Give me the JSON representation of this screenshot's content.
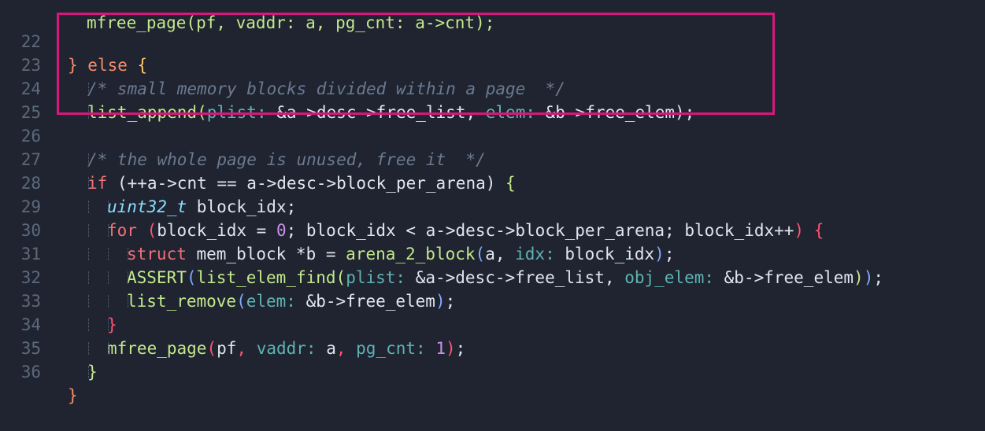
{
  "editor": {
    "top_partial": "mfree_page(pf, vaddr: a, pg_cnt: a->cnt);",
    "lines": [
      {
        "n": "22"
      },
      {
        "n": "23"
      },
      {
        "n": "24"
      },
      {
        "n": "25"
      },
      {
        "n": "26"
      },
      {
        "n": "27"
      },
      {
        "n": "28"
      },
      {
        "n": "29"
      },
      {
        "n": "30"
      },
      {
        "n": "31"
      },
      {
        "n": "32"
      },
      {
        "n": "33"
      },
      {
        "n": "34"
      },
      {
        "n": "35"
      },
      {
        "n": "36"
      }
    ],
    "tokens": {
      "l22_close": "}",
      "l22_else": " else ",
      "l22_open": "{",
      "l23_comment": "/* small memory blocks divided within a page  */",
      "l24_fn": "list_append",
      "l24_p1": "plist: ",
      "l24_a1": "&a->desc->free_list",
      "l24_comma": ", ",
      "l24_p2": "elem: ",
      "l24_a2": "&b->free_elem",
      "l24_end": ");",
      "l26_comment": "/* the whole page is unused, free it  */",
      "l27_if": "if",
      "l27_cond": " (++a->cnt == a->desc->block_per_arena) ",
      "l27_open": "{",
      "l28_type": "uint32_t",
      "l28_rest": " block_idx;",
      "l29_for": "for",
      "l29_open_paren": " (",
      "l29_init": "block_idx = ",
      "l29_zero": "0",
      "l29_rest": "; block_idx < a->desc->block_per_arena; block_idx++",
      "l29_close_paren": ")",
      "l29_brace": " {",
      "l30_struct": "struct",
      "l30_mid": " mem_block *b = ",
      "l30_fn": "arena_2_block",
      "l30_open": "(",
      "l30_a": "a",
      "l30_comma": ", ",
      "l30_p": "idx: ",
      "l30_arg": "block_idx",
      "l30_close": ")",
      "l30_end": ";",
      "l31_macro": "ASSERT",
      "l31_open": "(",
      "l31_fn": "list_elem_find",
      "l31_open2": "(",
      "l31_p1": "plist: ",
      "l31_a1": "&a->desc->free_list",
      "l31_comma": ", ",
      "l31_p2": "obj_elem: ",
      "l31_a2": "&b->free_elem",
      "l31_close2": ")",
      "l31_close": ")",
      "l31_end": ";",
      "l32_fn": "list_remove",
      "l32_open": "(",
      "l32_p": "elem: ",
      "l32_a": "&b->free_elem",
      "l32_close": ")",
      "l32_end": ";",
      "l33_close": "}",
      "l34_fn": "mfree_page",
      "l34_open": "(",
      "l34_a1": "pf",
      "l34_c1": ", ",
      "l34_p2": "vaddr: ",
      "l34_a2": "a",
      "l34_c2": ", ",
      "l34_p3": "pg_cnt: ",
      "l34_a3": "1",
      "l34_close": ")",
      "l34_end": ";",
      "l35_close": "}",
      "l36_close": "}"
    }
  },
  "colors": {
    "background": "#1f2430",
    "highlight_box": "#d6187a"
  }
}
